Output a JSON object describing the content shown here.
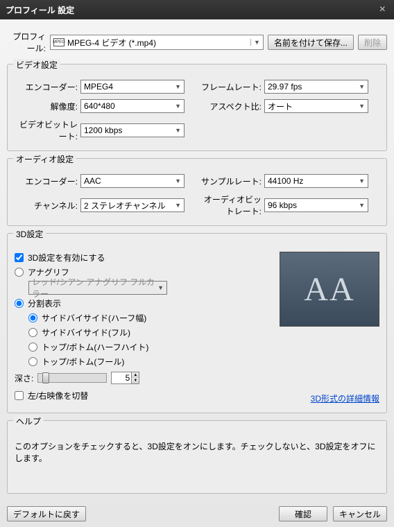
{
  "window": {
    "title": "プロフィール 設定",
    "close": "×"
  },
  "profile": {
    "label": "プロフィール:",
    "value": "MPEG-4 ビデオ (*.mp4)",
    "saveAs": "名前を付けて保存...",
    "delete": "削除"
  },
  "video": {
    "legend": "ビデオ設定",
    "encoder_label": "エンコーダー:",
    "encoder": "MPEG4",
    "framerate_label": "フレームレート:",
    "framerate": "29.97 fps",
    "resolution_label": "解像度:",
    "resolution": "640*480",
    "aspect_label": "アスペクト比:",
    "aspect": "オート",
    "bitrate_label": "ビデオビットレート:",
    "bitrate": "1200 kbps"
  },
  "audio": {
    "legend": "オーディオ設定",
    "encoder_label": "エンコーダー:",
    "encoder": "AAC",
    "samplerate_label": "サンプルレート:",
    "samplerate": "44100 Hz",
    "channel_label": "チャンネル:",
    "channel": "2 ステレオチャンネル",
    "bitrate_label": "オーディオビットレート:",
    "bitrate": "96 kbps"
  },
  "threeD": {
    "legend": "3D設定",
    "enable": "3D設定を有効にする",
    "anaglyph": "アナグリフ",
    "anaglyph_option": "レッド/シアン アナグリフ フルカラー",
    "split": "分割表示",
    "sbs_half": "サイドバイサイド(ハーフ幅)",
    "sbs_full": "サイドバイサイド(フル)",
    "tb_half": "トップ/ボトム(ハーフハイト)",
    "tb_full": "トップ/ボトム(フール)",
    "depth_label": "深さ:",
    "depth_value": "5",
    "swap": "左/右映像を切替",
    "link": "3D形式の詳細情報",
    "preview_text": "AA"
  },
  "help": {
    "legend": "ヘルプ",
    "text": "このオプションをチェックすると、3D設定をオンにします。チェックしないと、3D設定をオフにします。"
  },
  "footer": {
    "default": "デフォルトに戻す",
    "ok": "確認",
    "cancel": "キャンセル"
  }
}
